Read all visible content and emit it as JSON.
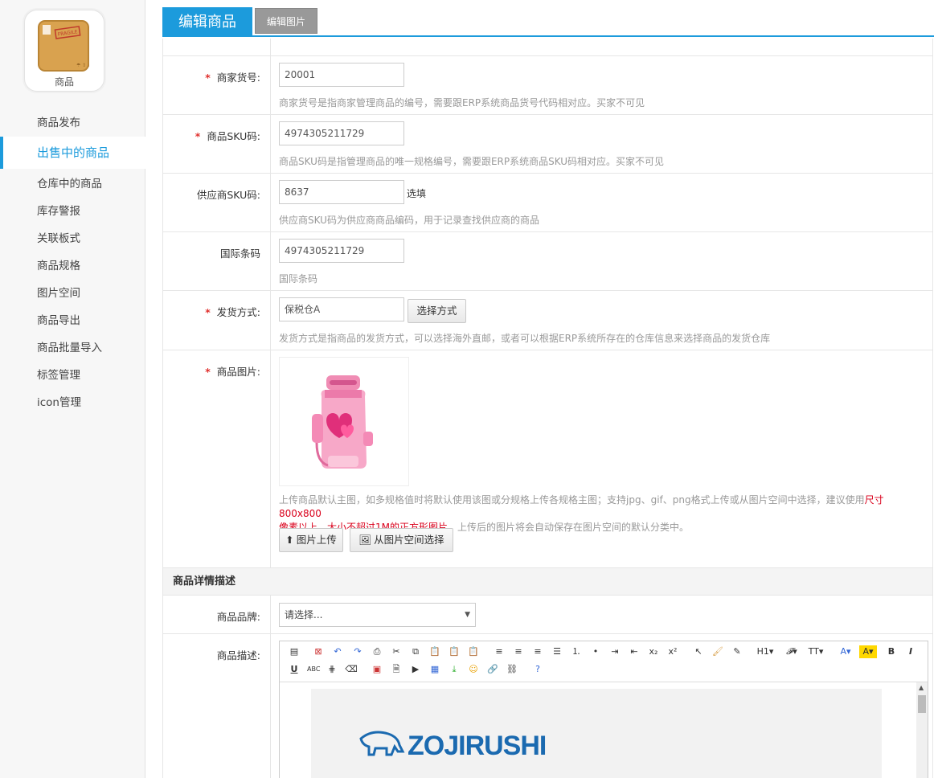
{
  "app": {
    "name": "商品",
    "box_text": "FRAGILE"
  },
  "nav": {
    "items": [
      {
        "label": "商品发布"
      },
      {
        "label": "出售中的商品"
      },
      {
        "label": "仓库中的商品"
      },
      {
        "label": "库存警报"
      },
      {
        "label": "关联板式"
      },
      {
        "label": "商品规格"
      },
      {
        "label": "图片空间"
      },
      {
        "label": "商品导出"
      },
      {
        "label": "商品批量导入"
      },
      {
        "label": "标签管理"
      },
      {
        "label": "icon管理"
      }
    ],
    "active_index": 1
  },
  "header": {
    "tab_main": "编辑商品",
    "tab_sub": "编辑图片"
  },
  "form": {
    "merchant_no": {
      "label": "商家货号:",
      "value": "20001",
      "hint": "商家货号是指商家管理商品的编号，需要跟ERP系统商品货号代码相对应。买家不可见"
    },
    "sku": {
      "label": "商品SKU码:",
      "value": "4974305211729",
      "hint": "商品SKU码是指管理商品的唯一规格编号，需要跟ERP系统商品SKU码相对应。买家不可见"
    },
    "supplier_sku": {
      "label": "供应商SKU码:",
      "value": "8637",
      "suffix": "选填",
      "hint": "供应商SKU码为供应商商品编码，用于记录查找供应商的商品"
    },
    "barcode": {
      "label": "国际条码",
      "value": "4974305211729",
      "hint": "国际条码"
    },
    "shipping": {
      "label": "发货方式:",
      "value": "保税仓A",
      "button": "选择方式",
      "hint": "发货方式是指商品的发货方式，可以选择海外直邮，或者可以根据ERP系统所存在的仓库信息来选择商品的发货仓库"
    },
    "image": {
      "label": "商品图片:",
      "hint_line1_a": "上传商品默认主图，如多规格值时将默认使用该图或分规格上传各规格主图；支持jpg、gif、png格式上传或从图片空间中选择，建议使用",
      "hint_line1_red": "尺寸800x800",
      "hint_line2_red": "像素以上、大小不超过1M的正方形图片",
      "hint_line2_b": "，上传后的图片将会自动保存在图片空间的默认分类中。",
      "upload_button": "图片上传",
      "space_button": "从图片空间选择"
    },
    "details_section": "商品详情描述",
    "brand": {
      "label": "商品品牌:",
      "placeholder": "请选择..."
    },
    "description": {
      "label": "商品描述:",
      "brand_logo_text": "ZOJIRUSHI"
    }
  },
  "colors": {
    "accent": "#1c9bdc",
    "required": "#e0302d",
    "warning": "#d9001b"
  }
}
